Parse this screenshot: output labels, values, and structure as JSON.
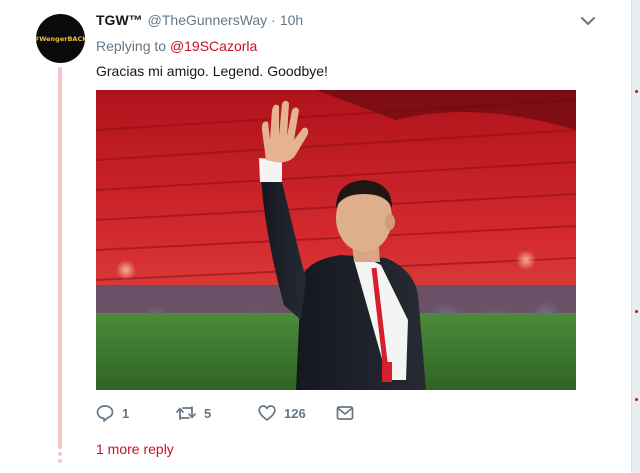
{
  "tweet": {
    "avatar_text": "#WengerBACK",
    "fullname": "TGW™",
    "handle": "@TheGunnersWay",
    "separator": "·",
    "time": "10h",
    "replying_prefix": "Replying to",
    "replying_to": "@19SCazorla",
    "text": "Gracias mi amigo. Legend. Goodbye!",
    "media_alt": "photo",
    "actions": {
      "reply_count": "1",
      "retweet_count": "5",
      "like_count": "126"
    },
    "more_replies": "1 more reply"
  },
  "icons": {
    "caret": "chevron-down-icon",
    "reply": "reply-icon",
    "retweet": "retweet-icon",
    "like": "heart-icon",
    "dm": "envelope-icon"
  },
  "colors": {
    "accent": "#c8102e",
    "thread_line": "#f5c5c9",
    "secondary_text": "#657786"
  }
}
